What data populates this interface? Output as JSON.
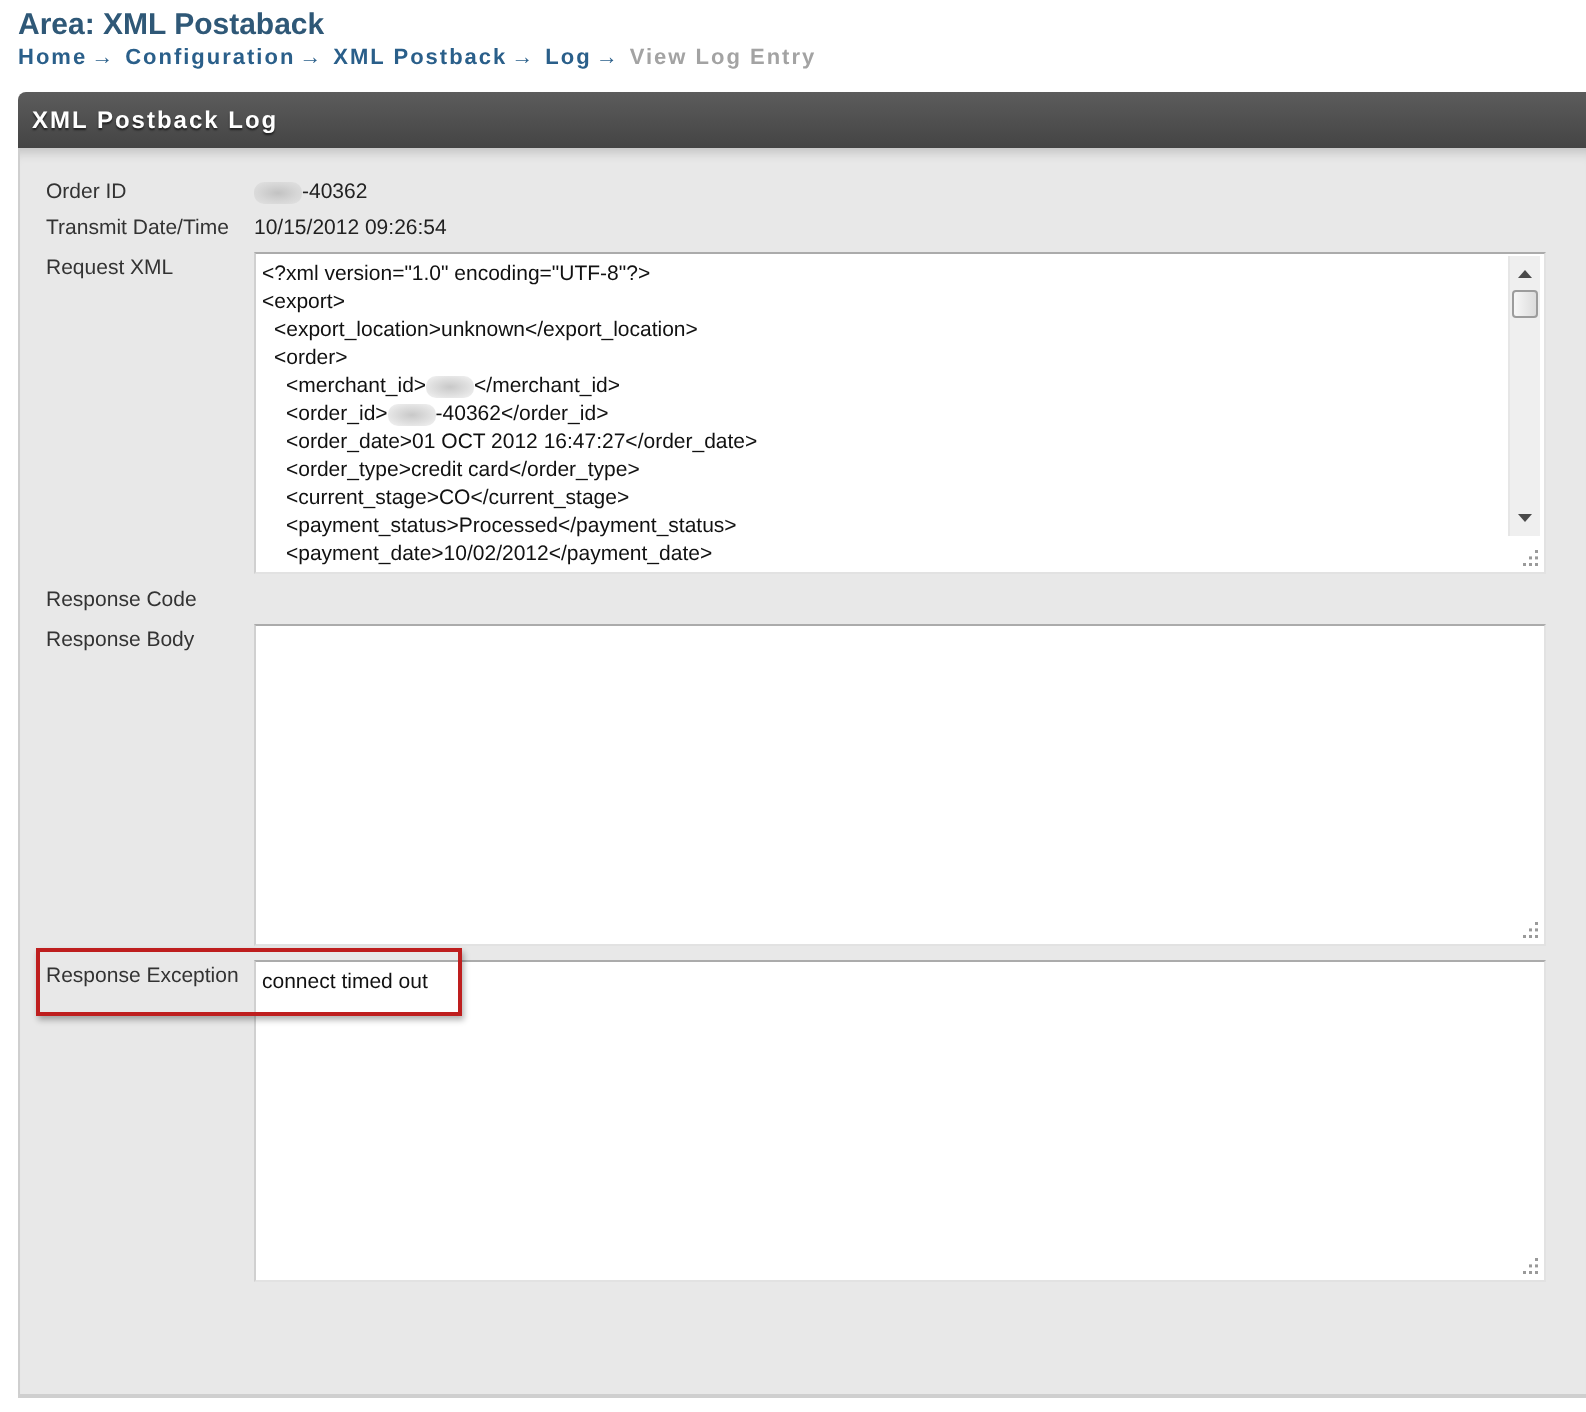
{
  "page": {
    "title": "Area: XML Postaback"
  },
  "breadcrumb": [
    {
      "label": "Home",
      "separator": "→",
      "current": false
    },
    {
      "label": "Configuration",
      "separator": "→",
      "current": false
    },
    {
      "label": "XML Postback",
      "separator": "→",
      "current": false
    },
    {
      "label": "Log",
      "separator": "→",
      "current": false
    },
    {
      "label": "View Log Entry",
      "current": true
    }
  ],
  "panel": {
    "title": "XML Postback Log",
    "rows": [
      {
        "label": "Order ID",
        "kind": "text",
        "highlighted": false,
        "segments": [
          {
            "kind": "blur"
          },
          {
            "kind": "text",
            "text": "-40362"
          }
        ]
      },
      {
        "label": "Transmit Date/Time",
        "kind": "text",
        "highlighted": false,
        "segments": [
          {
            "kind": "text",
            "text": "10/15/2012 09:26:54"
          }
        ]
      },
      {
        "label": "Request XML",
        "kind": "textarea",
        "highlighted": false,
        "scrollbar": true,
        "lines": [
          {
            "segments": [
              {
                "kind": "text",
                "text": "<?xml version=\"1.0\" encoding=\"UTF-8\"?>"
              }
            ]
          },
          {
            "segments": [
              {
                "kind": "text",
                "text": "<export>"
              }
            ],
            "children": [
              {
                "segments": [
                  {
                    "kind": "text",
                    "text": "<export_location>unknown</export_location>"
                  }
                ]
              },
              {
                "segments": [
                  {
                    "kind": "text",
                    "text": "<order>"
                  }
                ],
                "children": [
                  {
                    "segments": [
                      {
                        "kind": "text",
                        "text": "<merchant_id>"
                      },
                      {
                        "kind": "blur"
                      },
                      {
                        "kind": "text",
                        "text": "</merchant_id>"
                      }
                    ]
                  },
                  {
                    "segments": [
                      {
                        "kind": "text",
                        "text": "<order_id>"
                      },
                      {
                        "kind": "blur"
                      },
                      {
                        "kind": "text",
                        "text": "-40362</order_id>"
                      }
                    ]
                  },
                  {
                    "segments": [
                      {
                        "kind": "text",
                        "text": "<order_date>01 OCT 2012 16:47:27</order_date>"
                      }
                    ]
                  },
                  {
                    "segments": [
                      {
                        "kind": "text",
                        "text": "<order_type>credit card</order_type>"
                      }
                    ]
                  },
                  {
                    "segments": [
                      {
                        "kind": "text",
                        "text": "<current_stage>CO</current_stage>"
                      }
                    ]
                  },
                  {
                    "segments": [
                      {
                        "kind": "text",
                        "text": "<payment_status>Processed</payment_status>"
                      }
                    ]
                  },
                  {
                    "segments": [
                      {
                        "kind": "text",
                        "text": "<payment_date>10/02/2012</payment_date>"
                      }
                    ]
                  }
                ]
              }
            ]
          }
        ]
      },
      {
        "label": "Response Code",
        "kind": "text",
        "highlighted": false
      },
      {
        "label": "Response Body",
        "kind": "textarea",
        "highlighted": false,
        "scrollbar": false
      },
      {
        "label": "Response Exception",
        "kind": "textarea",
        "highlighted": true,
        "scrollbar": false,
        "lines": [
          {
            "segments": [
              {
                "kind": "text",
                "text": "connect timed out"
              }
            ]
          }
        ]
      }
    ]
  }
}
